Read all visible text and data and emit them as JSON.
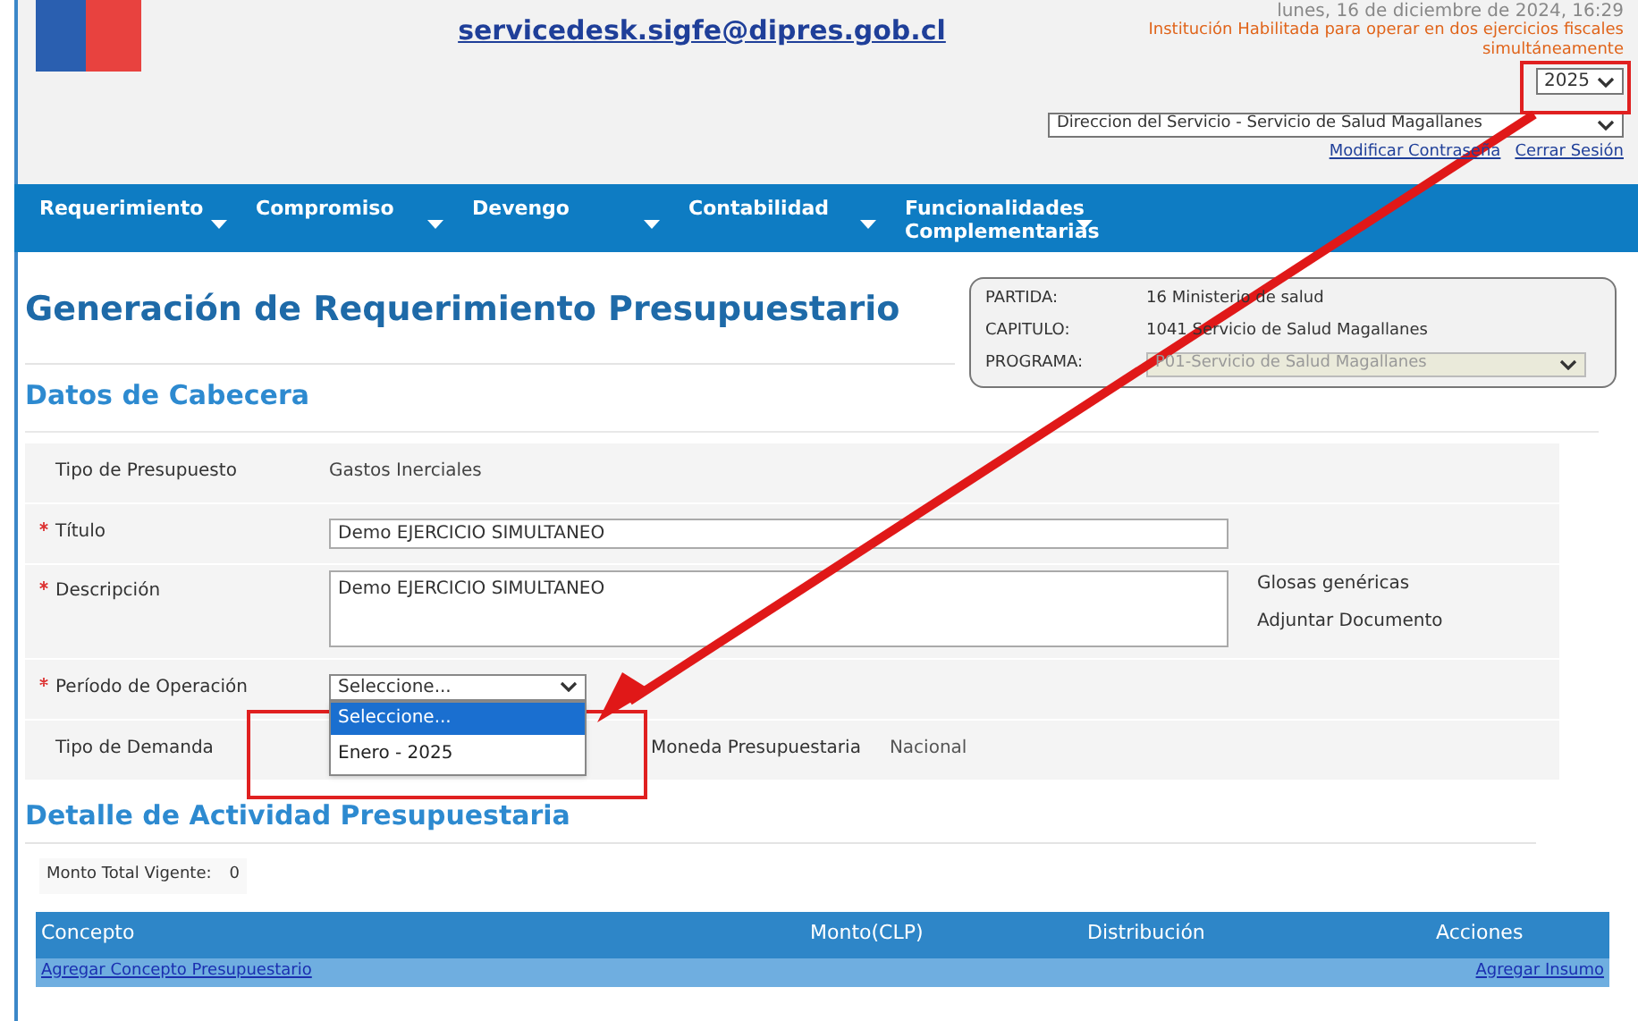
{
  "header": {
    "email": "servicedesk.sigfe@dipres.gob.cl",
    "date": "lunes, 16 de diciembre de 2024, 16:29",
    "notice": "Institución Habilitada para operar en dos ejercicios fiscales simultáneamente",
    "year": "2025",
    "service": "Direccion del Servicio - Servicio de Salud Magallanes",
    "links": [
      "Modificar Contraseña",
      "Cerrar Sesión"
    ]
  },
  "menu": [
    {
      "label": "Requerimiento"
    },
    {
      "label": "Compromiso"
    },
    {
      "label": "Devengo"
    },
    {
      "label": "Contabilidad"
    },
    {
      "label": "Funcionalidades Complementarias"
    }
  ],
  "page_title": "Generación de Requerimiento Presupuestario",
  "info": [
    {
      "label": "PARTIDA:",
      "value": "16 Ministerio de salud",
      "kind": "text"
    },
    {
      "label": "CAPITULO:",
      "value": "1041 Servicio de Salud Magallanes",
      "kind": "text"
    },
    {
      "label": "PROGRAMA:",
      "value": "P01-Servicio de Salud Magallanes",
      "kind": "select",
      "disabled": true
    }
  ],
  "section1": "Datos de Cabecera",
  "form": [
    {
      "label": "Tipo de Presupuesto",
      "required": false,
      "kind": "text",
      "value": "Gastos Inerciales"
    },
    {
      "label": "Título",
      "required": true,
      "kind": "input",
      "value": "Demo EJERCICIO SIMULTANEO"
    },
    {
      "label": "Descripción",
      "required": true,
      "kind": "textarea",
      "value": "Demo EJERCICIO SIMULTANEO",
      "side_links": [
        "Glosas genéricas",
        "Adjuntar Documento"
      ]
    },
    {
      "label": "Período de Operación",
      "required": true,
      "kind": "select",
      "value": "Seleccione...",
      "options": [
        {
          "label": "Seleccione...",
          "selected": true
        },
        {
          "label": "Enero - 2025",
          "selected": false
        }
      ]
    },
    {
      "label": "Tipo de Demanda",
      "required": false,
      "kind": "demand",
      "extra_label": "Moneda Presupuestaria",
      "extra_value": "Nacional"
    }
  ],
  "section2": "Detalle de Actividad Presupuestaria",
  "total": {
    "label": "Monto Total Vigente:",
    "value": "0"
  },
  "table": {
    "columns": [
      "Concepto",
      "Monto(CLP)",
      "Distribución",
      "Acciones"
    ],
    "links": [
      "Agregar Concepto Presupuestario",
      "Agregar Insumo"
    ]
  }
}
